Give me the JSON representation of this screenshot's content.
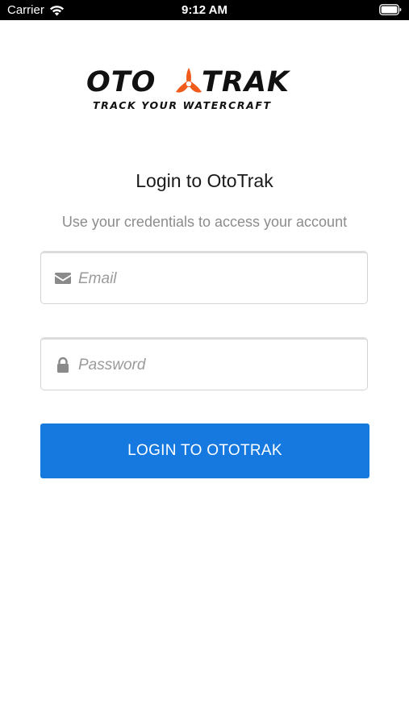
{
  "status_bar": {
    "carrier": "Carrier",
    "time": "9:12 AM",
    "wifi_icon": "wifi-icon",
    "battery_icon": "battery-icon"
  },
  "logo": {
    "word_left": "OTO",
    "word_right": "TRAK",
    "tagline": "TRACK YOUR WATERCRAFT",
    "mark_color": "#f05a1a"
  },
  "login": {
    "title": "Login to OtoTrak",
    "subtitle": "Use your credentials to access your account",
    "email": {
      "icon": "envelope-icon",
      "placeholder": "Email",
      "value": ""
    },
    "password": {
      "icon": "lock-icon",
      "placeholder": "Password",
      "value": ""
    },
    "button_label": "LOGIN TO OTOTRAK",
    "button_color": "#1579e0"
  }
}
